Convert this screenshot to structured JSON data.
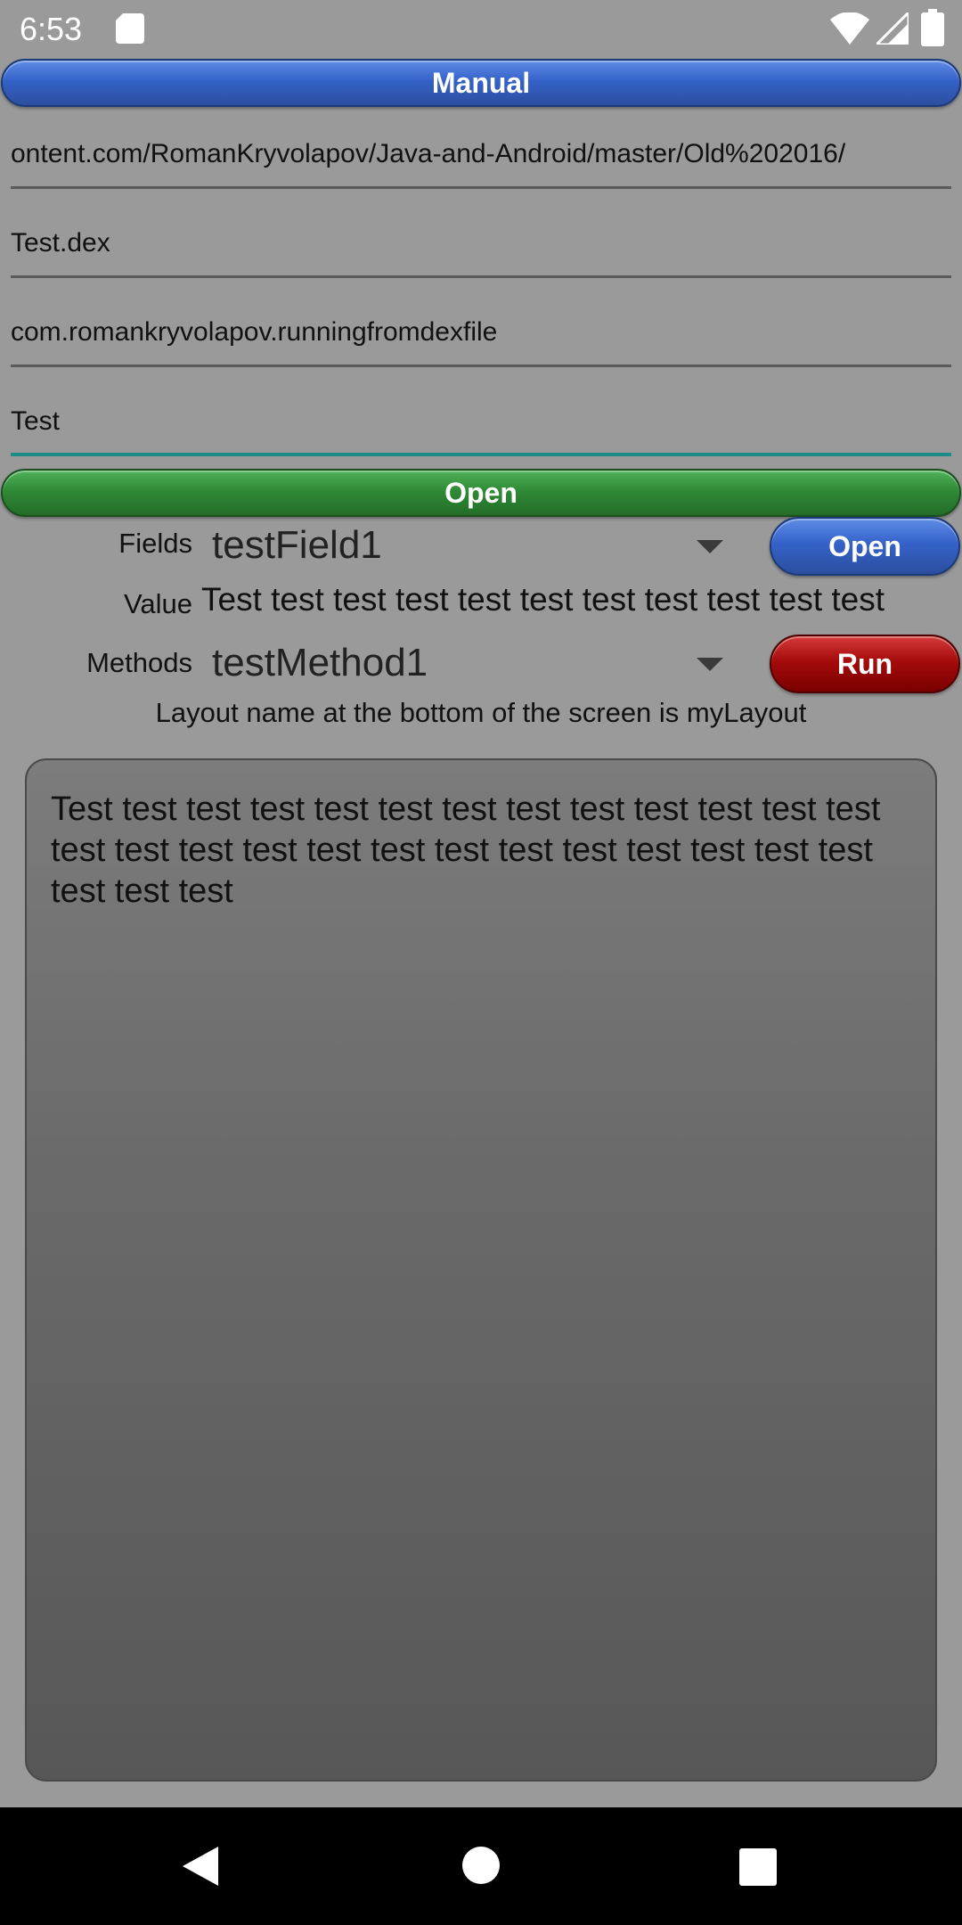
{
  "status_bar": {
    "time": "6:53"
  },
  "buttons": {
    "manual": "Manual",
    "open_main": "Open",
    "open_field": "Open",
    "run": "Run"
  },
  "fields": {
    "url": "ontent.com/RomanKryvolapov/Java-and-Android/master/Old%202016/",
    "file": "Test.dex",
    "package": "com.romankryvolapov.runningfromdexfile",
    "class": "Test"
  },
  "reflection": {
    "fields_label": "Fields",
    "fields_selected": "testField1",
    "value_label": "Value",
    "value_text": "Test test test test test test test test test test test",
    "methods_label": "Methods",
    "methods_selected": "testMethod1"
  },
  "layout_note": "Layout name at the bottom of the screen is myLayout",
  "output_text": "Test test test test test test test test test test test test test test test test test test test test test test test test test test test test test",
  "colors": {
    "blue_button": "#3562c9",
    "green_button": "#2f8a35",
    "red_button": "#a50b0b",
    "focused_underline": "#1e8c86",
    "background": "#9a9a9a"
  },
  "icons": {
    "status": [
      "sd-card-icon",
      "wifi-icon",
      "signal-icon",
      "battery-icon"
    ],
    "navigation": [
      "back-icon",
      "home-icon",
      "recents-icon"
    ],
    "spinner": "dropdown-arrow-icon"
  }
}
